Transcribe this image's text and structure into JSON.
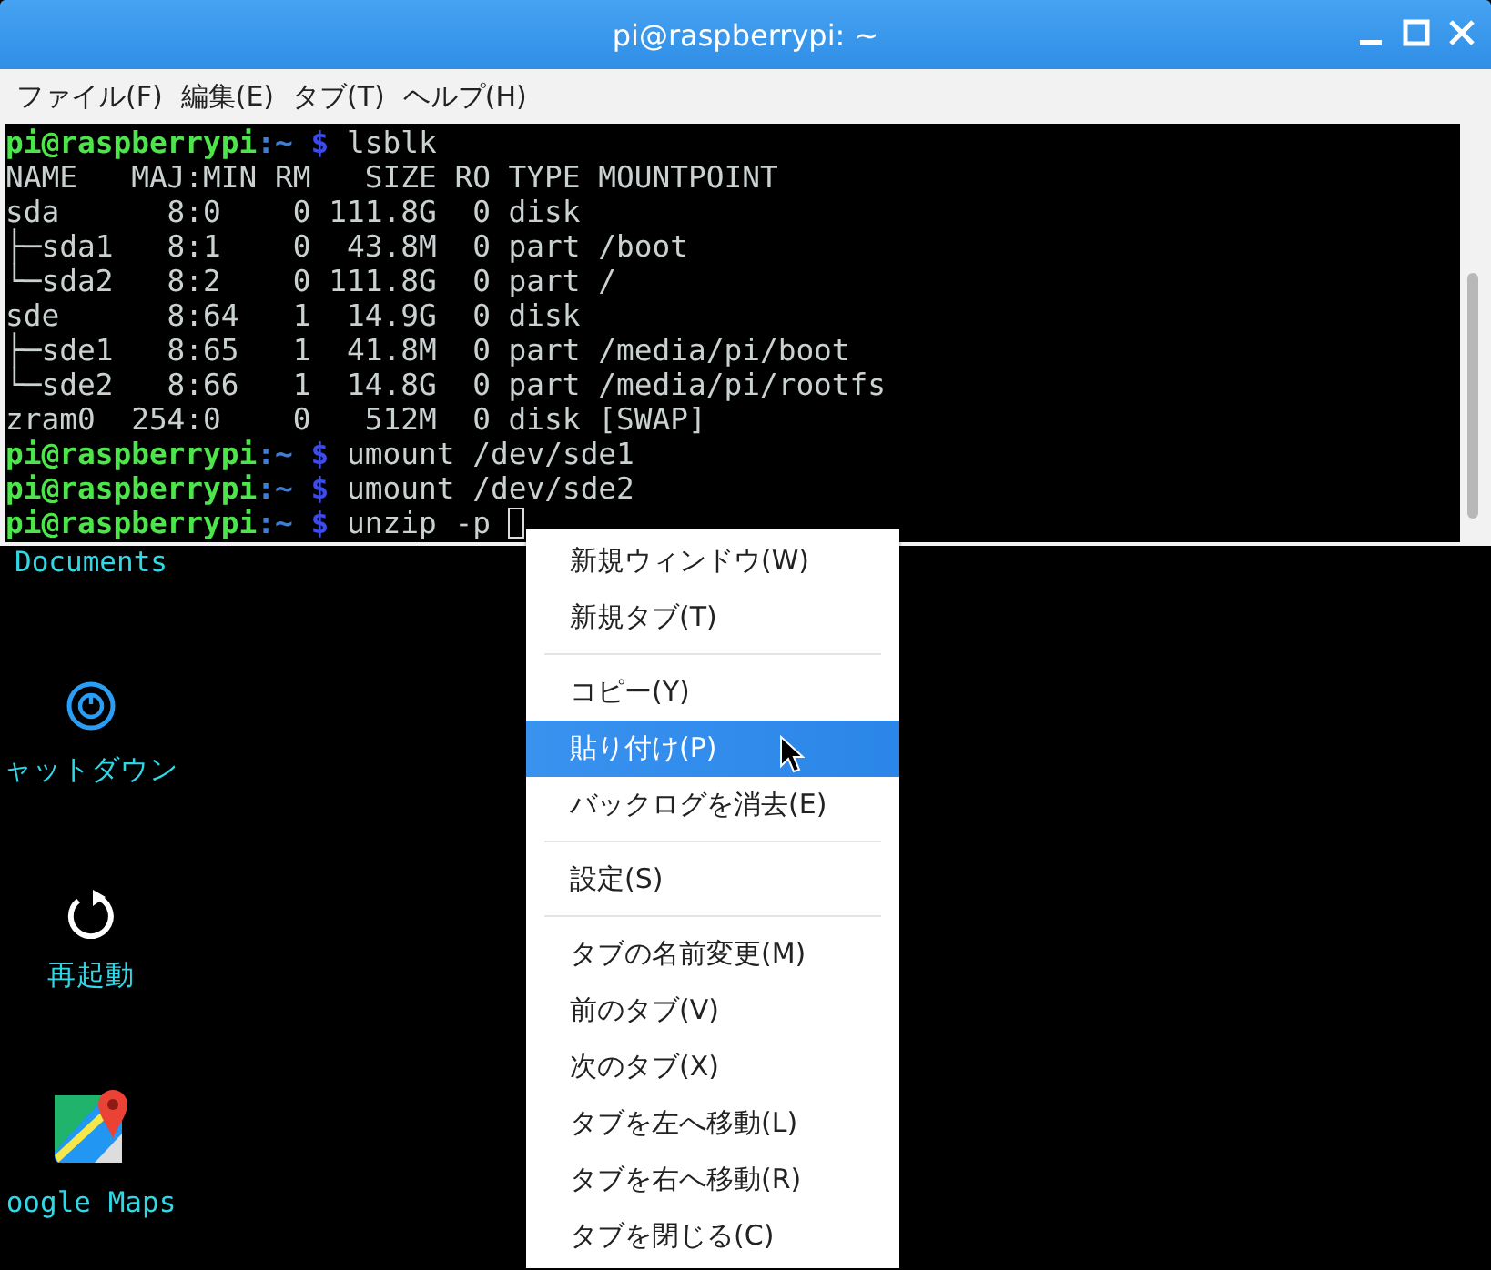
{
  "window": {
    "title": "pi@raspberrypi: ~"
  },
  "menubar": [
    "ファイル(F)",
    "編集(E)",
    "タブ(T)",
    "ヘルプ(H)"
  ],
  "terminal": {
    "lines": [
      {
        "kind": "prompt",
        "user": "pi@raspberrypi",
        "path": ":~",
        "symbol": "$",
        "command": "lsblk"
      },
      {
        "kind": "output",
        "text": "NAME   MAJ:MIN RM   SIZE RO TYPE MOUNTPOINT"
      },
      {
        "kind": "output",
        "text": "sda      8:0    0 111.8G  0 disk "
      },
      {
        "kind": "output",
        "text": "├─sda1   8:1    0  43.8M  0 part /boot"
      },
      {
        "kind": "output",
        "text": "└─sda2   8:2    0 111.8G  0 part /"
      },
      {
        "kind": "output",
        "text": "sde      8:64   1  14.9G  0 disk "
      },
      {
        "kind": "output",
        "text": "├─sde1   8:65   1  41.8M  0 part /media/pi/boot"
      },
      {
        "kind": "output",
        "text": "└─sde2   8:66   1  14.8G  0 part /media/pi/rootfs"
      },
      {
        "kind": "output",
        "text": "zram0  254:0    0   512M  0 disk [SWAP]"
      },
      {
        "kind": "prompt",
        "user": "pi@raspberrypi",
        "path": ":~",
        "symbol": "$",
        "command": "umount /dev/sde1"
      },
      {
        "kind": "prompt",
        "user": "pi@raspberrypi",
        "path": ":~",
        "symbol": "$",
        "command": "umount /dev/sde2"
      },
      {
        "kind": "prompt",
        "user": "pi@raspberrypi",
        "path": ":~",
        "symbol": "$",
        "command": "unzip -p",
        "cursor": true
      }
    ]
  },
  "desktop": [
    {
      "kind": "folder",
      "label": "Documents"
    },
    {
      "kind": "power",
      "label": "ャットダウン"
    },
    {
      "kind": "restart",
      "label": "再起動"
    },
    {
      "kind": "maps",
      "label": "oogle Maps"
    }
  ],
  "context_menu": [
    {
      "kind": "item",
      "label": "新規ウィンドウ(W)",
      "selected": false
    },
    {
      "kind": "item",
      "label": "新規タブ(T)",
      "selected": false
    },
    {
      "kind": "separator"
    },
    {
      "kind": "item",
      "label": "コピー(Y)",
      "selected": false
    },
    {
      "kind": "item",
      "label": "貼り付け(P)",
      "selected": true
    },
    {
      "kind": "item",
      "label": "バックログを消去(E)",
      "selected": false
    },
    {
      "kind": "separator"
    },
    {
      "kind": "item",
      "label": "設定(S)",
      "selected": false
    },
    {
      "kind": "separator"
    },
    {
      "kind": "item",
      "label": "タブの名前変更(M)",
      "selected": false
    },
    {
      "kind": "item",
      "label": "前のタブ(V)",
      "selected": false
    },
    {
      "kind": "item",
      "label": "次のタブ(X)",
      "selected": false
    },
    {
      "kind": "item",
      "label": "タブを左へ移動(L)",
      "selected": false
    },
    {
      "kind": "item",
      "label": "タブを右へ移動(R)",
      "selected": false
    },
    {
      "kind": "item",
      "label": "タブを閉じる(C)",
      "selected": false
    }
  ]
}
